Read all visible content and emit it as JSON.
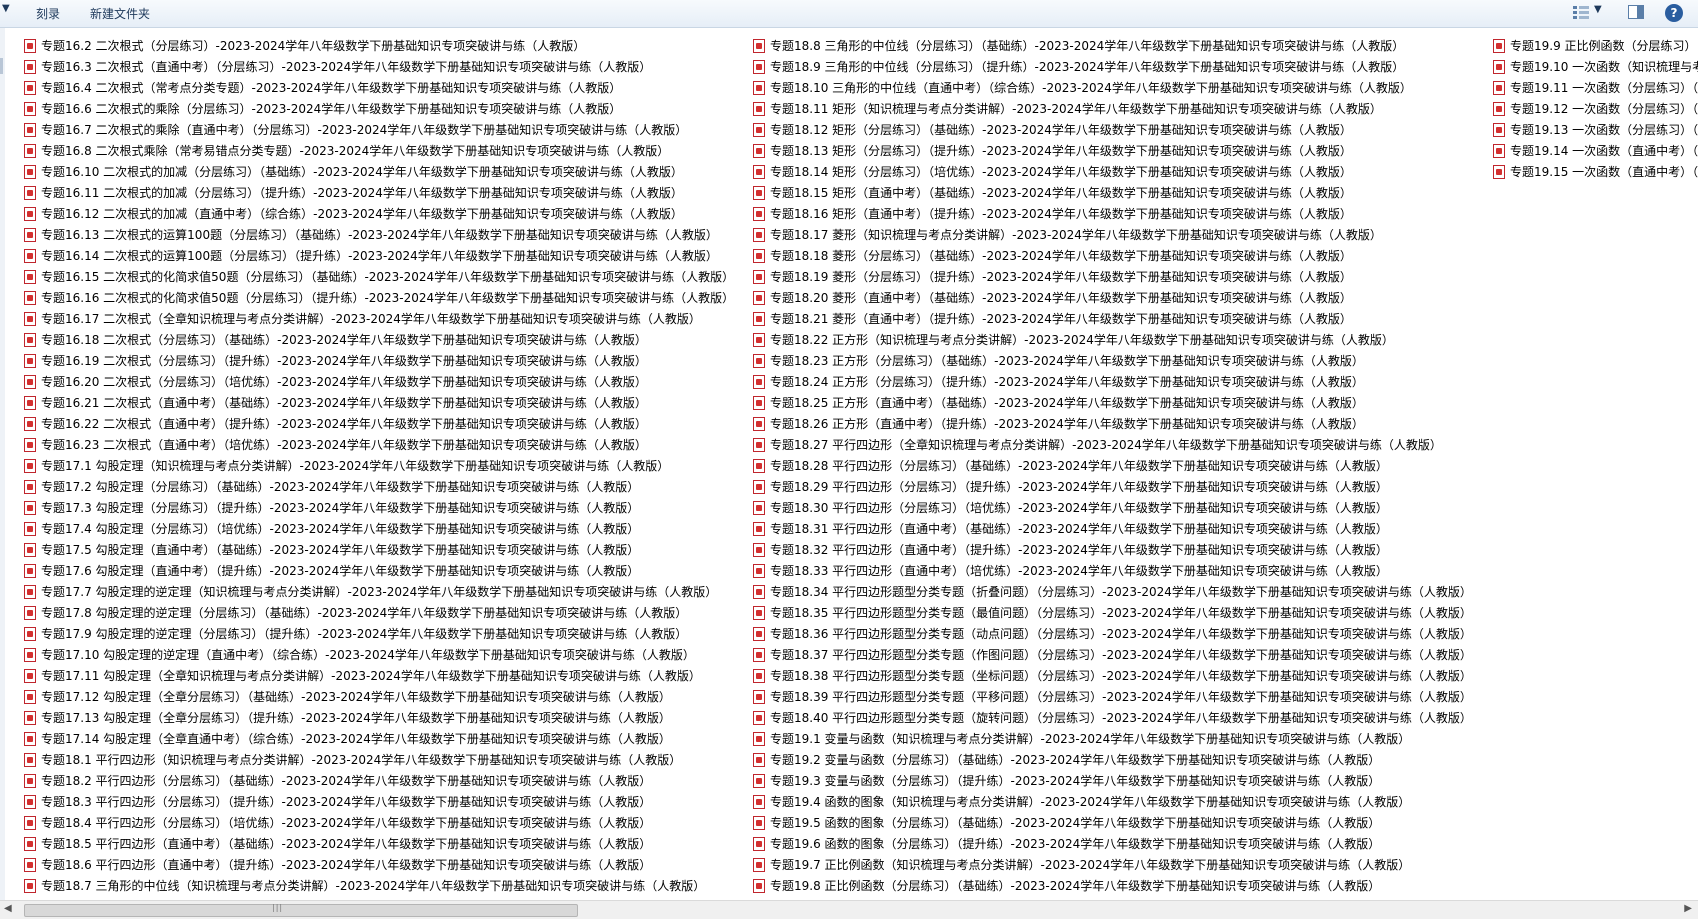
{
  "toolbar": {
    "burn_label": "刻录",
    "new_folder_label": "新建文件夹",
    "help_label": "?"
  },
  "files": {
    "col1": [
      "专题16.2 二次根式（分层练习）-2023-2024学年八年级数学下册基础知识专项突破讲与练（人教版）",
      "专题16.3 二次根式（直通中考）（分层练习）-2023-2024学年八年级数学下册基础知识专项突破讲与练（人教版）",
      "专题16.4 二次根式（常考点分类专题）-2023-2024学年八年级数学下册基础知识专项突破讲与练（人教版）",
      "专题16.6 二次根式的乘除（分层练习）-2023-2024学年八年级数学下册基础知识专项突破讲与练（人教版）",
      "专题16.7 二次根式的乘除（直通中考）（分层练习）-2023-2024学年八年级数学下册基础知识专项突破讲与练（人教版）",
      "专题16.8 二次根式乘除（常考易错点分类专题）-2023-2024学年八年级数学下册基础知识专项突破讲与练（人教版）",
      "专题16.10 二次根式的加减（分层练习）（基础练）-2023-2024学年八年级数学下册基础知识专项突破讲与练（人教版）",
      "专题16.11 二次根式的加减（分层练习）（提升练）-2023-2024学年八年级数学下册基础知识专项突破讲与练（人教版）",
      "专题16.12 二次根式的加减（直通中考）（综合练）-2023-2024学年八年级数学下册基础知识专项突破讲与练（人教版）",
      "专题16.13 二次根式的运算100题（分层练习）（基础练）-2023-2024学年八年级数学下册基础知识专项突破讲与练（人教版）",
      "专题16.14 二次根式的运算100题（分层练习）（提升练）-2023-2024学年八年级数学下册基础知识专项突破讲与练（人教版）",
      "专题16.15 二次根式的化简求值50题（分层练习）（基础练）-2023-2024学年八年级数学下册基础知识专项突破讲与练（人教版）",
      "专题16.16 二次根式的化简求值50题（分层练习）（提升练）-2023-2024学年八年级数学下册基础知识专项突破讲与练（人教版）",
      "专题16.17 二次根式（全章知识梳理与考点分类讲解）-2023-2024学年八年级数学下册基础知识专项突破讲与练（人教版）",
      "专题16.18 二次根式（分层练习）（基础练）-2023-2024学年八年级数学下册基础知识专项突破讲与练（人教版）",
      "专题16.19 二次根式（分层练习）（提升练）-2023-2024学年八年级数学下册基础知识专项突破讲与练（人教版）",
      "专题16.20 二次根式（分层练习）（培优练）-2023-2024学年八年级数学下册基础知识专项突破讲与练（人教版）",
      "专题16.21 二次根式（直通中考）（基础练）-2023-2024学年八年级数学下册基础知识专项突破讲与练（人教版）",
      "专题16.22 二次根式（直通中考）（提升练）-2023-2024学年八年级数学下册基础知识专项突破讲与练（人教版）",
      "专题16.23 二次根式（直通中考）（培优练）-2023-2024学年八年级数学下册基础知识专项突破讲与练（人教版）",
      "专题17.1 勾股定理（知识梳理与考点分类讲解）-2023-2024学年八年级数学下册基础知识专项突破讲与练（人教版）",
      "专题17.2 勾股定理（分层练习）（基础练）-2023-2024学年八年级数学下册基础知识专项突破讲与练（人教版）",
      "专题17.3 勾股定理（分层练习）（提升练）-2023-2024学年八年级数学下册基础知识专项突破讲与练（人教版）",
      "专题17.4 勾股定理（分层练习）（培优练）-2023-2024学年八年级数学下册基础知识专项突破讲与练（人教版）",
      "专题17.5 勾股定理（直通中考）（基础练）-2023-2024学年八年级数学下册基础知识专项突破讲与练（人教版）",
      "专题17.6 勾股定理（直通中考）（提升练）-2023-2024学年八年级数学下册基础知识专项突破讲与练（人教版）",
      "专题17.7 勾股定理的逆定理（知识梳理与考点分类讲解）-2023-2024学年八年级数学下册基础知识专项突破讲与练（人教版）",
      "专题17.8 勾股定理的逆定理（分层练习）（基础练）-2023-2024学年八年级数学下册基础知识专项突破讲与练（人教版）",
      "专题17.9 勾股定理的逆定理（分层练习）（提升练）-2023-2024学年八年级数学下册基础知识专项突破讲与练（人教版）",
      "专题17.10 勾股定理的逆定理（直通中考）（综合练）-2023-2024学年八年级数学下册基础知识专项突破讲与练（人教版）",
      "专题17.11 勾股定理（全章知识梳理与考点分类讲解）-2023-2024学年八年级数学下册基础知识专项突破讲与练（人教版）",
      "专题17.12 勾股定理（全章分层练习）（基础练）-2023-2024学年八年级数学下册基础知识专项突破讲与练（人教版）",
      "专题17.13 勾股定理（全章分层练习）（提升练）-2023-2024学年八年级数学下册基础知识专项突破讲与练（人教版）",
      "专题17.14 勾股定理（全章直通中考）（综合练）-2023-2024学年八年级数学下册基础知识专项突破讲与练（人教版）",
      "专题18.1 平行四边形（知识梳理与考点分类讲解）-2023-2024学年八年级数学下册基础知识专项突破讲与练（人教版）",
      "专题18.2 平行四边形（分层练习）（基础练）-2023-2024学年八年级数学下册基础知识专项突破讲与练（人教版）",
      "专题18.3 平行四边形（分层练习）（提升练）-2023-2024学年八年级数学下册基础知识专项突破讲与练（人教版）",
      "专题18.4 平行四边形（分层练习）（培优练）-2023-2024学年八年级数学下册基础知识专项突破讲与练（人教版）",
      "专题18.5 平行四边形（直通中考）（基础练）-2023-2024学年八年级数学下册基础知识专项突破讲与练（人教版）",
      "专题18.6 平行四边形（直通中考）（提升练）-2023-2024学年八年级数学下册基础知识专项突破讲与练（人教版）",
      "专题18.7 三角形的中位线（知识梳理与考点分类讲解）-2023-2024学年八年级数学下册基础知识专项突破讲与练（人教版）"
    ],
    "col2": [
      "专题18.8 三角形的中位线（分层练习）（基础练）-2023-2024学年八年级数学下册基础知识专项突破讲与练（人教版）",
      "专题18.9 三角形的中位线（分层练习）（提升练）-2023-2024学年八年级数学下册基础知识专项突破讲与练（人教版）",
      "专题18.10 三角形的中位线（直通中考）（综合练）-2023-2024学年八年级数学下册基础知识专项突破讲与练（人教版）",
      "专题18.11 矩形（知识梳理与考点分类讲解）-2023-2024学年八年级数学下册基础知识专项突破讲与练（人教版）",
      "专题18.12 矩形（分层练习）（基础练）-2023-2024学年八年级数学下册基础知识专项突破讲与练（人教版）",
      "专题18.13 矩形（分层练习）（提升练）-2023-2024学年八年级数学下册基础知识专项突破讲与练（人教版）",
      "专题18.14 矩形（分层练习）（培优练）-2023-2024学年八年级数学下册基础知识专项突破讲与练（人教版）",
      "专题18.15 矩形（直通中考）（基础练）-2023-2024学年八年级数学下册基础知识专项突破讲与练（人教版）",
      "专题18.16 矩形（直通中考）（提升练）-2023-2024学年八年级数学下册基础知识专项突破讲与练（人教版）",
      "专题18.17 菱形（知识梳理与考点分类讲解）-2023-2024学年八年级数学下册基础知识专项突破讲与练（人教版）",
      "专题18.18 菱形（分层练习）（基础练）-2023-2024学年八年级数学下册基础知识专项突破讲与练（人教版）",
      "专题18.19 菱形（分层练习）（提升练）-2023-2024学年八年级数学下册基础知识专项突破讲与练（人教版）",
      "专题18.20 菱形（直通中考）（基础练）-2023-2024学年八年级数学下册基础知识专项突破讲与练（人教版）",
      "专题18.21 菱形（直通中考）（提升练）-2023-2024学年八年级数学下册基础知识专项突破讲与练（人教版）",
      "专题18.22 正方形（知识梳理与考点分类讲解）-2023-2024学年八年级数学下册基础知识专项突破讲与练（人教版）",
      "专题18.23 正方形（分层练习）（基础练）-2023-2024学年八年级数学下册基础知识专项突破讲与练（人教版）",
      "专题18.24 正方形（分层练习）（提升练）-2023-2024学年八年级数学下册基础知识专项突破讲与练（人教版）",
      "专题18.25 正方形（直通中考）（基础练）-2023-2024学年八年级数学下册基础知识专项突破讲与练（人教版）",
      "专题18.26 正方形（直通中考）（提升练）-2023-2024学年八年级数学下册基础知识专项突破讲与练（人教版）",
      "专题18.27 平行四边形（全章知识梳理与考点分类讲解）-2023-2024学年八年级数学下册基础知识专项突破讲与练（人教版）",
      "专题18.28 平行四边形（分层练习）（基础练）-2023-2024学年八年级数学下册基础知识专项突破讲与练（人教版）",
      "专题18.29 平行四边形（分层练习）（提升练）-2023-2024学年八年级数学下册基础知识专项突破讲与练（人教版）",
      "专题18.30 平行四边形（分层练习）（培优练）-2023-2024学年八年级数学下册基础知识专项突破讲与练（人教版）",
      "专题18.31 平行四边形（直通中考）（基础练）-2023-2024学年八年级数学下册基础知识专项突破讲与练（人教版）",
      "专题18.32 平行四边形（直通中考）（提升练）-2023-2024学年八年级数学下册基础知识专项突破讲与练（人教版）",
      "专题18.33 平行四边形（直通中考）（培优练）-2023-2024学年八年级数学下册基础知识专项突破讲与练（人教版）",
      "专题18.34 平行四边形题型分类专题（折叠问题）（分层练习）-2023-2024学年八年级数学下册基础知识专项突破讲与练（人教版）",
      "专题18.35 平行四边形题型分类专题（最值问题）（分层练习）-2023-2024学年八年级数学下册基础知识专项突破讲与练（人教版）",
      "专题18.36 平行四边形题型分类专题（动点问题）（分层练习）-2023-2024学年八年级数学下册基础知识专项突破讲与练（人教版）",
      "专题18.37 平行四边形题型分类专题（作图问题）（分层练习）-2023-2024学年八年级数学下册基础知识专项突破讲与练（人教版）",
      "专题18.38 平行四边形题型分类专题（坐标问题）（分层练习）-2023-2024学年八年级数学下册基础知识专项突破讲与练（人教版）",
      "专题18.39 平行四边形题型分类专题（平移问题）（分层练习）-2023-2024学年八年级数学下册基础知识专项突破讲与练（人教版）",
      "专题18.40 平行四边形题型分类专题（旋转问题）（分层练习）-2023-2024学年八年级数学下册基础知识专项突破讲与练（人教版）",
      "专题19.1 变量与函数（知识梳理与考点分类讲解）-2023-2024学年八年级数学下册基础知识专项突破讲与练（人教版）",
      "专题19.2 变量与函数（分层练习）（基础练）-2023-2024学年八年级数学下册基础知识专项突破讲与练（人教版）",
      "专题19.3 变量与函数（分层练习）（提升练）-2023-2024学年八年级数学下册基础知识专项突破讲与练（人教版）",
      "专题19.4 函数的图象（知识梳理与考点分类讲解）-2023-2024学年八年级数学下册基础知识专项突破讲与练（人教版）",
      "专题19.5 函数的图象（分层练习）（基础练）-2023-2024学年八年级数学下册基础知识专项突破讲与练（人教版）",
      "专题19.6 函数的图象（分层练习）（提升练）-2023-2024学年八年级数学下册基础知识专项突破讲与练（人教版）",
      "专题19.7 正比例函数（知识梳理与考点分类讲解）-2023-2024学年八年级数学下册基础知识专项突破讲与练（人教版）",
      "专题19.8 正比例函数（分层练习）（基础练）-2023-2024学年八年级数学下册基础知识专项突破讲与练（人教版）"
    ],
    "col3": [
      "专题19.9 正比例函数（分层练习）",
      "专题19.10 一次函数（知识梳理与考",
      "专题19.11 一次函数（分层练习）（",
      "专题19.12 一次函数（分层练习）（",
      "专题19.13 一次函数（分层练习）（",
      "专题19.14 一次函数（直通中考）（",
      "专题19.15 一次函数（直通中考）（"
    ]
  }
}
